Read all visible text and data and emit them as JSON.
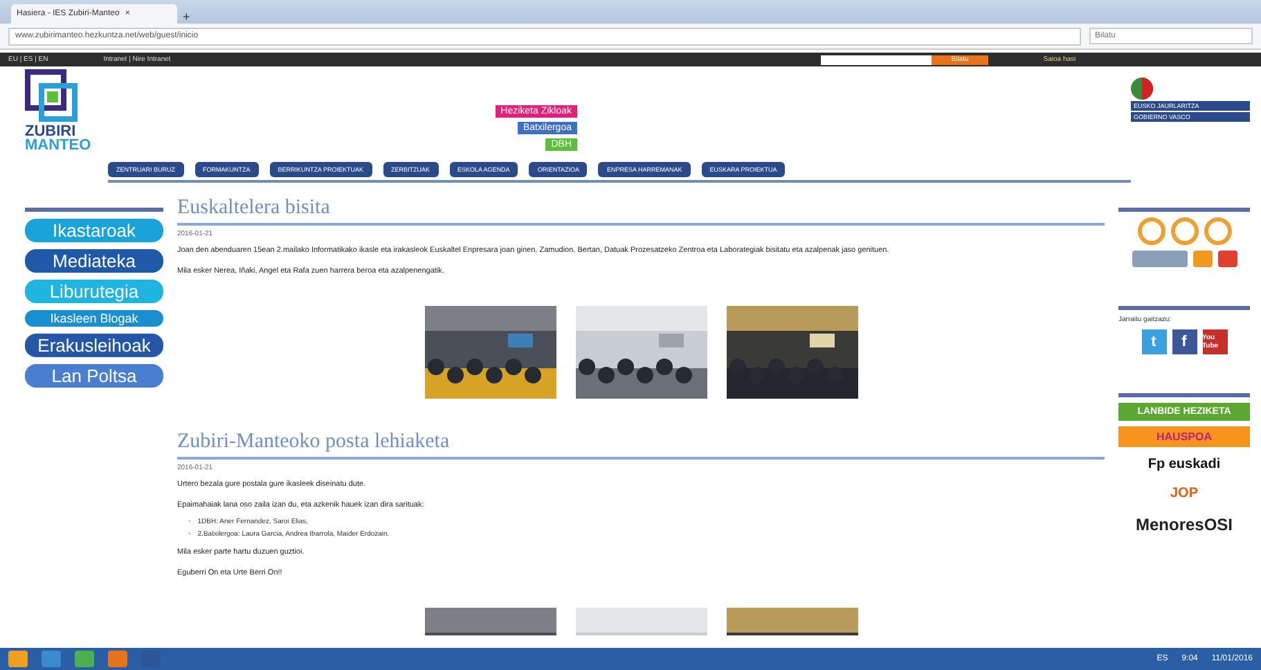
{
  "browser": {
    "tab_title": "Hasiera - IES Zubiri-Manteo",
    "tab_close": "×",
    "new_tab": "+",
    "url": "www.zubirimanteo.hezkuntza.net/web/guest/inicio",
    "search_placeholder": "Bilatu"
  },
  "top_bar": {
    "languages": "EU | ES | EN",
    "links": "Intranet | Nire Intranet",
    "search_button": "Bilatu",
    "login": "Saioa hasi"
  },
  "header": {
    "logo_line1": "ZUBIRI",
    "logo_line2": "MANTEO",
    "level_links": [
      {
        "label": "Heziketa Zikloak",
        "color": "#e0207a"
      },
      {
        "label": "Batxilergoa",
        "color": "#3f6fc0"
      },
      {
        "label": "DBH",
        "color": "#5cbf3a"
      }
    ],
    "gov_line1": "EUSKO JAURLARITZA",
    "gov_line2": "GOBIERNO VASCO"
  },
  "nav": [
    "ZENTRUARI BURUZ",
    "FORMAKUNTZA",
    "BERRIKUNTZA PROIEKTUAK",
    "ZERBITZUAK",
    "ESKOLA AGENDA",
    "ORIENTAZIOA",
    "ENPRESA HARREMANAK",
    "EUSKARA PROIEKTUA"
  ],
  "left_menu": [
    {
      "label": "Ikastaroak",
      "color": "#1aa3d9"
    },
    {
      "label": "Mediateka",
      "color": "#1f5aa8"
    },
    {
      "label": "Liburutegia",
      "color": "#1fb5e0"
    },
    {
      "label": "Ikasleen Blogak",
      "color": "#1a8fd0"
    },
    {
      "label": "Erakusleihoak",
      "color": "#2458a6"
    },
    {
      "label": "Lan Poltsa",
      "color": "#4a7fd0"
    }
  ],
  "posts": [
    {
      "title": "Euskaltelera bisita",
      "date": "2016-01-21",
      "paragraphs": [
        "Joan den abenduaren 15ean 2.mailako Informatikako ikasle eta irakasleok Euskaltel Enpresara joan ginen. Zamudion. Bertan, Datuak Prozesatzeko Zentroa eta Laborategiak bisitatu eta azalpenak jaso genituen.",
        "Mila esker Nerea, Iñaki, Angel eta Rafa zuen harrera beroa eta azalpenengatik."
      ],
      "photos": [
        {
          "kind": "picture"
        },
        {
          "kind": "picture"
        },
        {
          "kind": "picture"
        }
      ]
    },
    {
      "title": "Zubiri-Manteoko posta lehiaketa",
      "date": "2016-01-21",
      "paragraphs": [
        "Urtero bezala gure postala gure ikasleek diseinatu dute.",
        "Epaimahaiak lana oso zaila izan du, eta azkenik hauek izan dira sarituak:"
      ],
      "bullets": [
        {
          "marker": "◦",
          "text": "1DBH: Aner Fernandez, Saroi Elias,"
        },
        {
          "marker": "◦",
          "text": "2.Batxilergoa: Laura Garcia, Andrea Ibarrola, Maider Erdozain."
        }
      ],
      "closing": [
        "Mila esker parte hartu duzuen guztioi.",
        "Eguberri On eta Urte Berri On!!"
      ],
      "photos": [
        {
          "kind": "picture"
        },
        {
          "kind": "picture"
        },
        {
          "kind": "picture"
        }
      ]
    }
  ],
  "right": {
    "follow_label": "Jarraitu gaitzazu:",
    "social": [
      "t",
      "f",
      "You Tube"
    ],
    "banners": [
      {
        "label": "LANBIDE HEZIKETA",
        "color": "#5aa832"
      },
      {
        "label": "HAUSPOA",
        "color": "#f7941d"
      },
      {
        "label": "Fp euskadi",
        "color": "#ffffff"
      },
      {
        "label": "JOP",
        "color": "#ffffff"
      },
      {
        "label": "MenoresOSI",
        "color": "#ffffff"
      }
    ]
  },
  "taskbar": {
    "language": "ES",
    "time": "9:04",
    "date": "11/01/2016"
  }
}
